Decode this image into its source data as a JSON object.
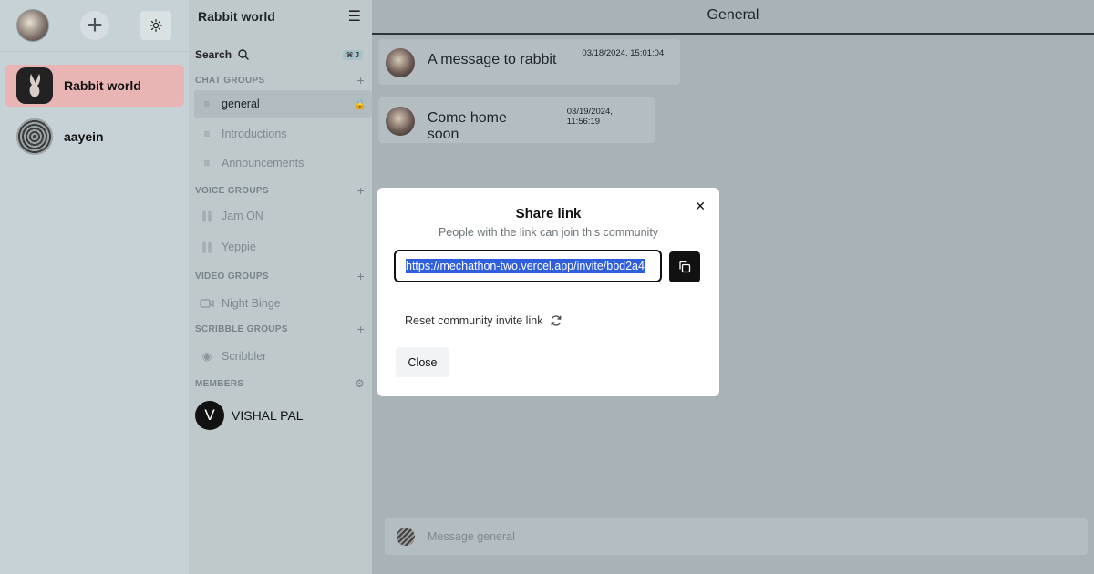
{
  "rail": {
    "servers": [
      {
        "name": "Rabbit world",
        "active": true
      },
      {
        "name": "aayein",
        "active": false
      }
    ]
  },
  "sidebar": {
    "title": "Rabbit world",
    "search_label": "Search",
    "search_shortcut": "⌘ J",
    "chat_groups": {
      "header": "CHAT GROUPS",
      "items": [
        "general",
        "Introductions",
        "Announcements"
      ]
    },
    "voice_groups": {
      "header": "VOICE GROUPS",
      "items": [
        "Jam ON",
        "Yeppie"
      ]
    },
    "video_groups": {
      "header": "VIDEO GROUPS",
      "items": [
        "Night Binge"
      ]
    },
    "scribble_groups": {
      "header": "SCRIBBLE GROUPS",
      "items": [
        "Scribbler"
      ]
    },
    "members": {
      "header": "MEMBERS",
      "items": [
        {
          "initial": "V",
          "name": "VISHAL PAL"
        }
      ]
    }
  },
  "main": {
    "title": "General",
    "messages": [
      {
        "text": "A message to rabbit",
        "time": "03/18/2024, 15:01:04"
      },
      {
        "text": "Come home soon",
        "time": "03/19/2024, 11:56:19"
      }
    ],
    "composer_placeholder": "Message general"
  },
  "modal": {
    "title": "Share link",
    "subtitle": "People with the link can join this community",
    "invite_link": "https://mechathon-two.vercel.app/invite/bbd2a4",
    "reset_label": "Reset community invite link",
    "close_label": "Close"
  },
  "colors": {
    "active_server": "#e9b4b4",
    "selection": "#2f5fdd",
    "modal_bg": "#ffffff"
  }
}
